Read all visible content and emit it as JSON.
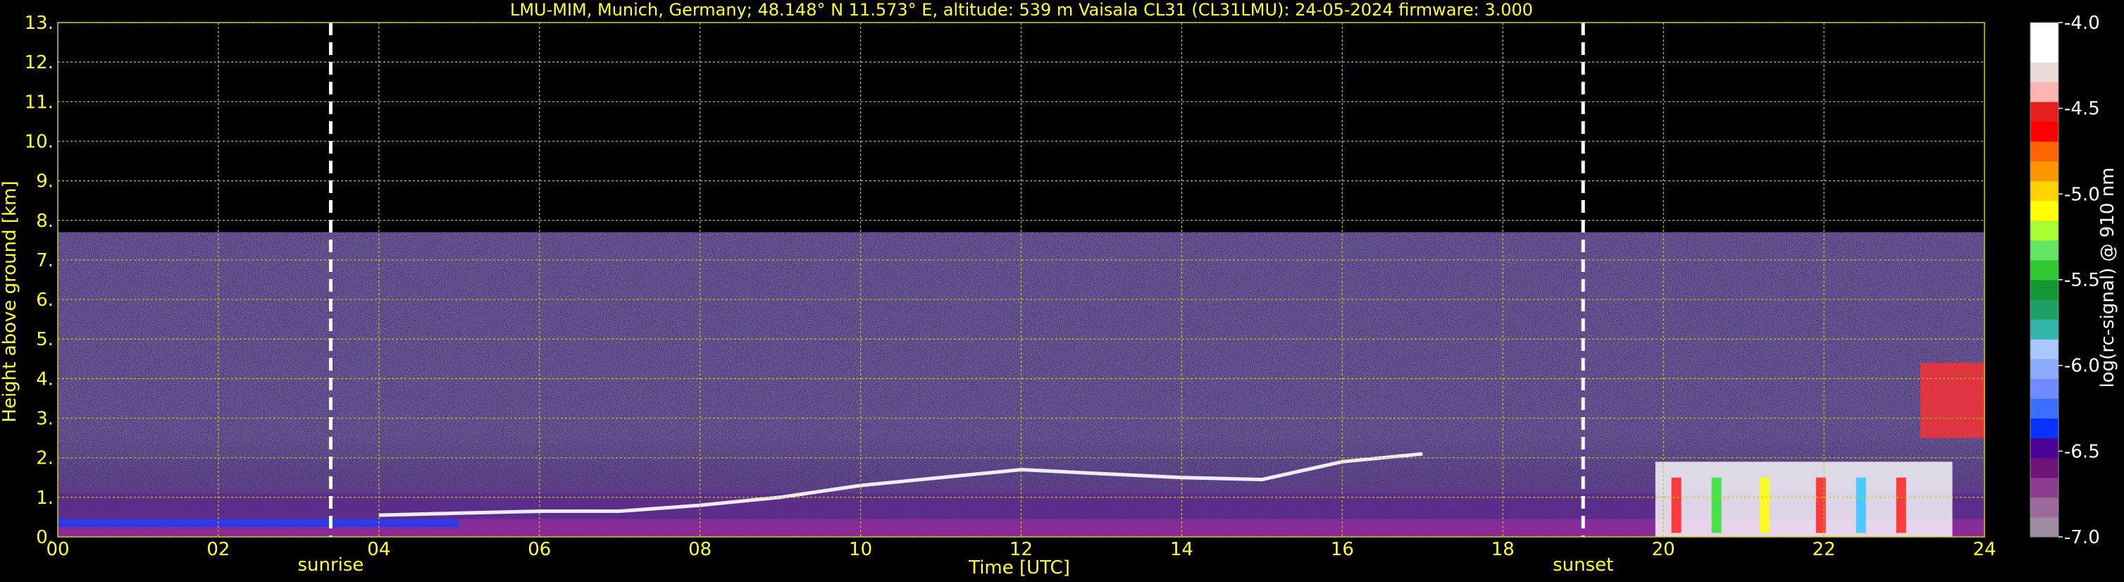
{
  "chart_data": {
    "type": "heatmap",
    "title": "LMU-MIM, Munich, Germany; 48.148° N 11.573° E, altitude: 539 m    Vaisala CL31 (CL31LMU): 24-05-2024    firmware: 3.000",
    "xlabel": "Time [UTC]",
    "ylabel": "Height above ground [km]",
    "xlim": [
      0,
      24
    ],
    "ylim": [
      0,
      13
    ],
    "x_ticks": [
      "00",
      "02",
      "04",
      "06",
      "08",
      "10",
      "12",
      "14",
      "16",
      "18",
      "20",
      "22",
      "24"
    ],
    "y_ticks": [
      "0.",
      "1.",
      "2.",
      "3.",
      "4.",
      "5.",
      "6.",
      "7.",
      "8.",
      "9.",
      "10.",
      "11.",
      "12.",
      "13."
    ],
    "grid": true,
    "data_top_km": 7.7,
    "markers": [
      {
        "label": "sunrise",
        "x": 3.4
      },
      {
        "label": "sunset",
        "x": 19.0
      }
    ],
    "colorbar": {
      "label": "log(rc-signal) @ 910 nm",
      "range": [
        -7.0,
        -4.0
      ],
      "ticks": [
        "-4.0",
        "-4.5",
        "-5.0",
        "-5.5",
        "-6.0",
        "-6.5",
        "-7.0"
      ],
      "colors": [
        "#a08ca0",
        "#9a6a9a",
        "#8c3c8c",
        "#6e1478",
        "#4b0096",
        "#0a32ff",
        "#3c6eff",
        "#6e8cff",
        "#8caaff",
        "#aac8ff",
        "#32b4aa",
        "#1ea064",
        "#149632",
        "#32c832",
        "#64e664",
        "#aaff32",
        "#ffff00",
        "#ffd200",
        "#ff9600",
        "#ff6400",
        "#ff0000",
        "#e61e1e",
        "#ffb4b4",
        "#ebdcdc",
        "#ffffff",
        "#ffffff"
      ]
    },
    "features": [
      {
        "name": "boundary layer aerosol",
        "x_start": 0,
        "x_end": 24,
        "y_bottom": 0,
        "y_top": 0.45,
        "color": "#8c2a9a"
      },
      {
        "name": "morning blue layer",
        "x_start": 0,
        "x_end": 5.0,
        "y_bottom": 0.25,
        "y_top": 0.45,
        "color": "#1a3cff"
      },
      {
        "name": "residual layer",
        "x_start": 0,
        "x_end": 24,
        "y_bottom": 0.45,
        "y_top": 1.1,
        "color": "#5a2a8a"
      },
      {
        "name": "evening clouds",
        "x_start": 19.9,
        "x_end": 23.6,
        "y_bottom": 0.0,
        "y_top": 1.9,
        "color": "#ffffff"
      },
      {
        "name": "evening clouds upper",
        "x_start": 23.2,
        "x_end": 24.0,
        "y_bottom": 2.5,
        "y_top": 4.4,
        "color": "#ff3030"
      }
    ],
    "layer_tops": {
      "x": [
        4.0,
        5.0,
        6.0,
        7.0,
        8.0,
        9.0,
        10.0,
        11.0,
        12.0,
        13.0,
        14.0,
        15.0,
        16.0,
        17.0
      ],
      "y": [
        0.55,
        0.6,
        0.65,
        0.65,
        0.8,
        1.0,
        1.3,
        1.5,
        1.7,
        1.6,
        1.5,
        1.45,
        1.9,
        2.1
      ]
    }
  }
}
